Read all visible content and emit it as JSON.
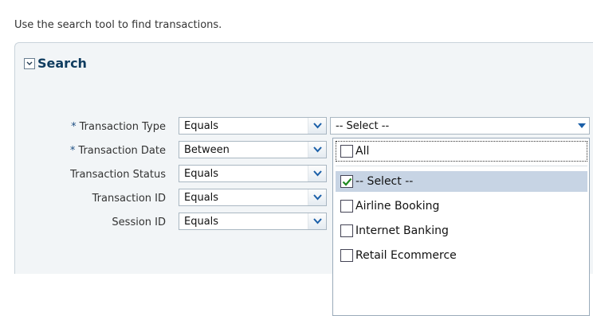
{
  "intro_text": "Use the search tool to find transactions.",
  "panel": {
    "title": "Search",
    "disclose_icon": "chevron-down-icon"
  },
  "required_marker": "*",
  "fields": [
    {
      "label": "Transaction Type",
      "required": true,
      "operator": "Equals"
    },
    {
      "label": "Transaction Date",
      "required": true,
      "operator": "Between"
    },
    {
      "label": "Transaction Status",
      "required": false,
      "operator": "Equals"
    },
    {
      "label": "Transaction ID",
      "required": false,
      "operator": "Equals"
    },
    {
      "label": "Session ID",
      "required": false,
      "operator": "Equals"
    }
  ],
  "value_select": {
    "value": "-- Select --"
  },
  "dropdown": {
    "options": [
      {
        "label": "All",
        "checked": false,
        "selected": false,
        "focused": true
      },
      {
        "label": "-- Select --",
        "checked": true,
        "selected": true,
        "focused": false
      },
      {
        "label": "Airline Booking",
        "checked": false,
        "selected": false,
        "focused": false
      },
      {
        "label": "Internet Banking",
        "checked": false,
        "selected": false,
        "focused": false
      },
      {
        "label": "Retail Ecommerce",
        "checked": false,
        "selected": false,
        "focused": false
      }
    ]
  },
  "colors": {
    "panel_bg": "#f2f5f7",
    "title": "#0f3c5f",
    "selected_option_bg": "#c7d4e4",
    "checkmark": "#1f8a1f",
    "arrow": "#1a5fa8"
  }
}
